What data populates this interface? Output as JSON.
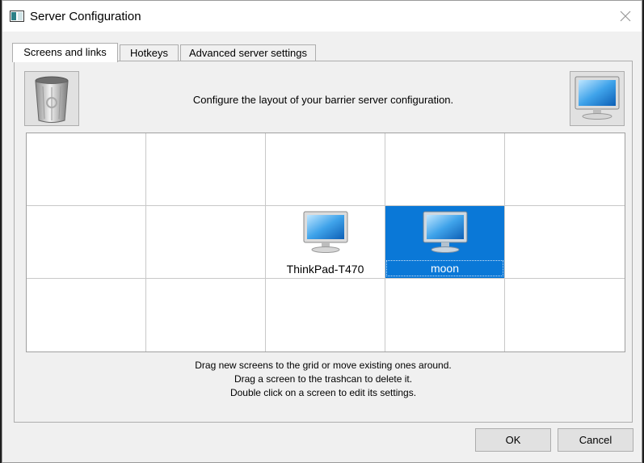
{
  "window": {
    "title": "Server Configuration"
  },
  "tabs": [
    {
      "label": "Screens and links",
      "active": true
    },
    {
      "label": "Hotkeys",
      "active": false
    },
    {
      "label": "Advanced server settings",
      "active": false
    }
  ],
  "panel": {
    "description": "Configure the layout of your barrier server configuration.",
    "help_lines": [
      "Drag new screens to the grid or move existing ones around.",
      "Drag a screen to the trashcan to delete it.",
      "Double click on a screen to edit its settings."
    ]
  },
  "grid": {
    "columns": 5,
    "rows": 3,
    "screens": [
      {
        "name": "ThinkPad-T470",
        "row": 2,
        "col": 3,
        "selected": false
      },
      {
        "name": "moon",
        "row": 2,
        "col": 4,
        "selected": true
      }
    ]
  },
  "buttons": {
    "ok": "OK",
    "cancel": "Cancel"
  },
  "colors": {
    "selection": "#0a78d7",
    "window_bg": "#f0f0f0",
    "button_bg": "#e1e1e1"
  },
  "icons": [
    "app-icon",
    "close-icon",
    "trash-icon",
    "monitor-icon"
  ]
}
